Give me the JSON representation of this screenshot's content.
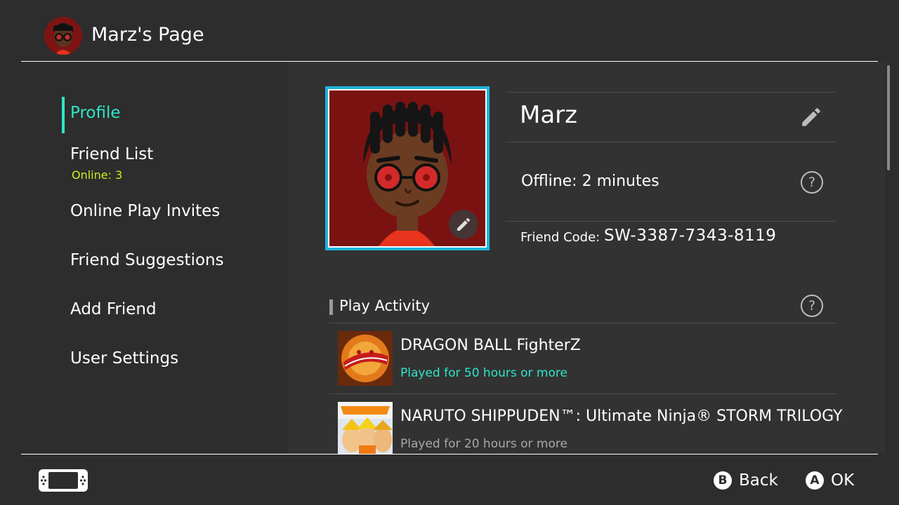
{
  "header": {
    "title": "Marz's Page",
    "avatar_icon": "mii-avatar"
  },
  "sidebar": {
    "items": [
      {
        "label": "Profile",
        "active": true
      },
      {
        "label": "Friend List",
        "sub": "Online: 3"
      },
      {
        "label": "Online Play Invites"
      },
      {
        "label": "Friend Suggestions"
      },
      {
        "label": "Add Friend"
      },
      {
        "label": "User Settings"
      }
    ]
  },
  "profile": {
    "name": "Marz",
    "status": "Offline: 2 minutes",
    "friend_code_label": "Friend Code:",
    "friend_code": "SW-3387-7343-8119",
    "help_glyph": "?"
  },
  "play_activity": {
    "title": "Play Activity",
    "games": [
      {
        "title": "DRAGON BALL FighterZ",
        "played": "Played for 50 hours or more"
      },
      {
        "title": "NARUTO SHIPPUDEN™: Ultimate Ninja® STORM TRILOGY",
        "played": "Played for 20 hours or more"
      }
    ]
  },
  "footer": {
    "back_button": "B",
    "back_label": "Back",
    "ok_button": "A",
    "ok_label": "OK"
  },
  "colors": {
    "background": "#2d2d2d",
    "accent": "#2ee6c8",
    "online": "#c8f01e",
    "picture_border": "#1eb4dc",
    "played_highlight": "#2ee6c8",
    "played_muted": "#a8a8a8"
  }
}
